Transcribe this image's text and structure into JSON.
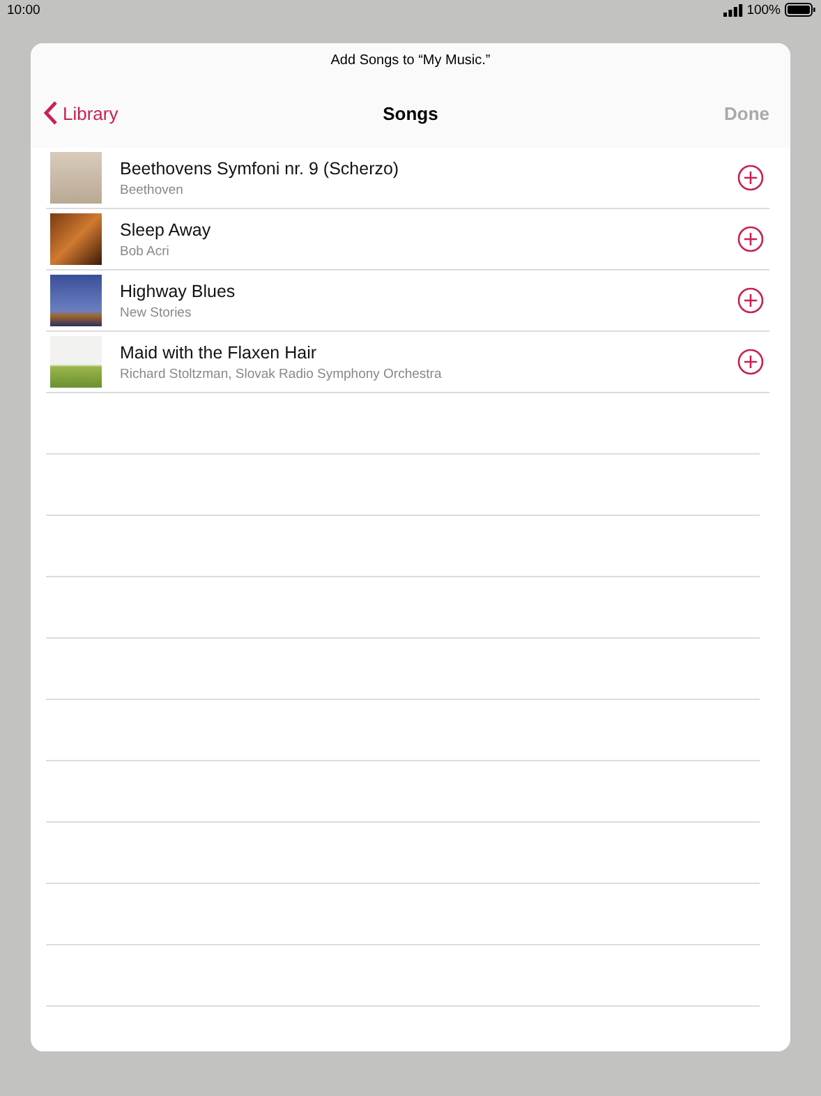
{
  "status_bar": {
    "time": "10:00",
    "battery": "100%"
  },
  "sheet": {
    "prompt": "Add Songs to “My Music.”",
    "back": "Library",
    "title": "Songs",
    "done": {
      "label": "Done",
      "disabled": true
    }
  },
  "songs": [
    {
      "title": "Beethovens Symfoni nr. 9 (Scherzo)",
      "artist": "Beethoven"
    },
    {
      "title": "Sleep Away",
      "artist": "Bob Acri"
    },
    {
      "title": "Highway Blues",
      "artist": "New Stories"
    },
    {
      "title": "Maid with the Flaxen Hair",
      "artist": "Richard Stoltzman, Slovak Radio Symphony Orchestra"
    }
  ]
}
